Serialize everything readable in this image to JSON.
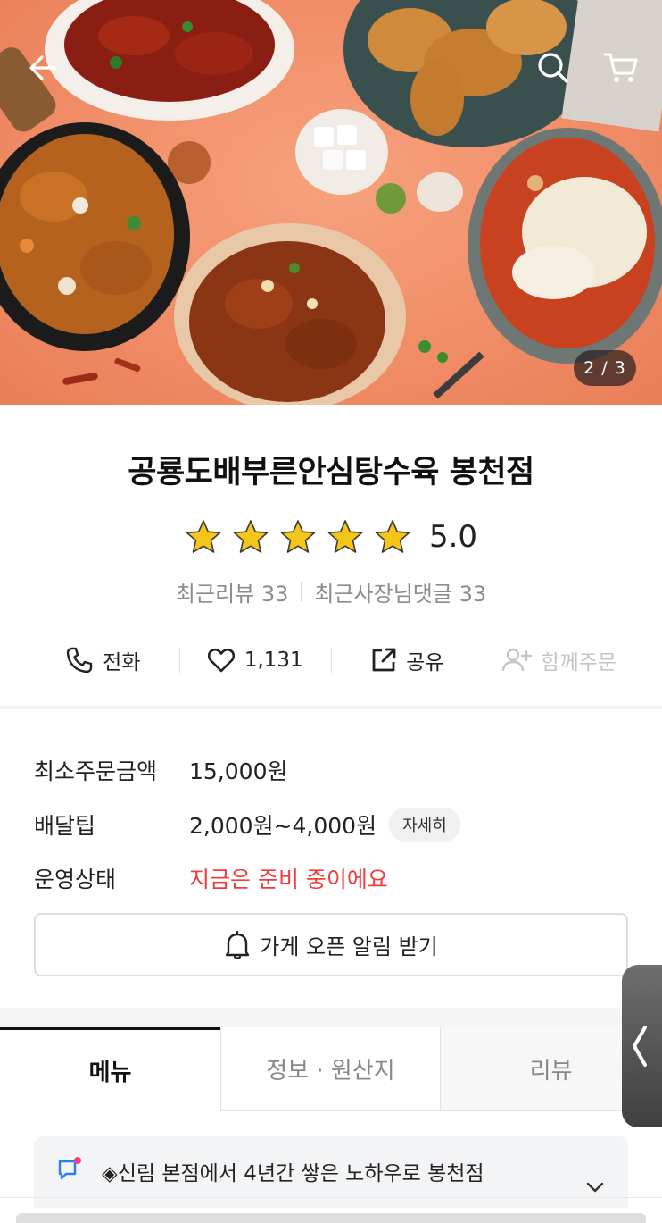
{
  "hero": {
    "pager": "2 / 3",
    "icons": {
      "back": "arrow-left-icon",
      "search": "search-icon",
      "cart": "cart-icon"
    }
  },
  "store": {
    "name": "공룡도배부른안심탕수육 봉천점",
    "rating": "5.0",
    "stars": 5,
    "recent_reviews": "최근리뷰 33",
    "owner_replies": "최근사장님댓글 33"
  },
  "actions": {
    "call": "전화",
    "like_count": "1,131",
    "share": "공유",
    "group_order": "함께주문"
  },
  "info": {
    "min_order_label": "최소주문금액",
    "min_order_value": "15,000원",
    "delivery_tip_label": "배달팁",
    "delivery_tip_value": "2,000원~4,000원",
    "detail_chip": "자세히",
    "status_label": "운영상태",
    "status_value": "지금은 준비 중이에요",
    "notify_button": "가게 오픈 알림 받기"
  },
  "tabs": [
    {
      "label": "메뉴",
      "active": true
    },
    {
      "label": "정보 · 원산지",
      "active": false
    },
    {
      "label": "리뷰",
      "active": false
    }
  ],
  "notice": {
    "text": "◈신림 본점에서 4년간 쌓은 노하우로 봉천점"
  },
  "colors": {
    "accent_red": "#ef3e3e",
    "hero_orange": "#f08c66",
    "star_yellow": "#f5c518",
    "notice_icon_blue": "#2b7df0"
  }
}
